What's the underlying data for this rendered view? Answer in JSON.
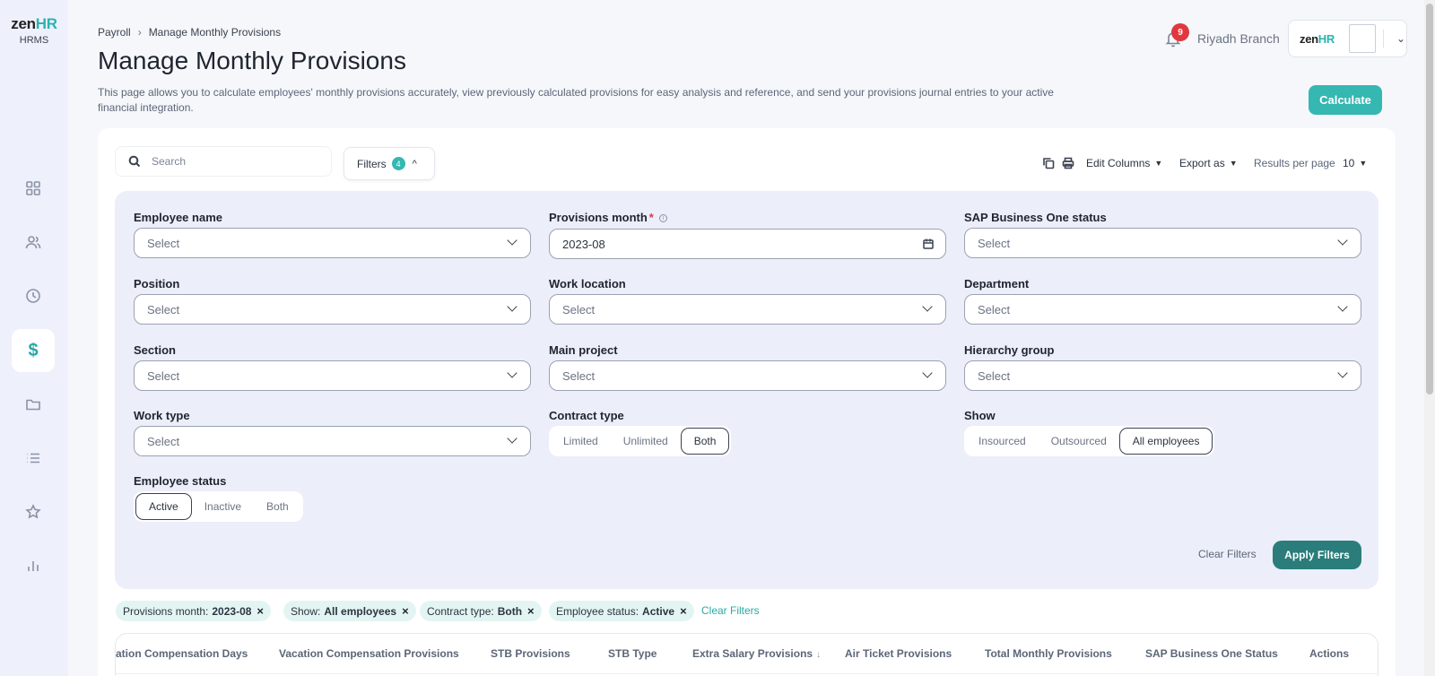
{
  "app": {
    "logo_main": "zen",
    "logo_accent": "HR",
    "logo_sub": "HRMS"
  },
  "sidebar": {
    "items": [
      {
        "name": "dashboard",
        "icon": "grid-icon"
      },
      {
        "name": "employees",
        "icon": "people-icon"
      },
      {
        "name": "time",
        "icon": "clock-icon"
      },
      {
        "name": "payroll",
        "icon": "dollar-icon",
        "active": true,
        "glyph": "$"
      },
      {
        "name": "documents",
        "icon": "folder-icon"
      },
      {
        "name": "lists",
        "icon": "list-icon"
      },
      {
        "name": "performance",
        "icon": "star-icon"
      },
      {
        "name": "reports",
        "icon": "bar-chart-icon"
      }
    ]
  },
  "header": {
    "breadcrumb": [
      "Payroll",
      "Manage Monthly Provisions"
    ],
    "title": "Manage Monthly Provisions",
    "description": "This page allows you to calculate employees' monthly provisions accurately, view previously calculated provisions for easy analysis and reference, and send your provisions journal entries to your active financial integration.",
    "notifications_count": "9",
    "branch": "Riyadh Branch",
    "company_logo": "zenHR",
    "calculate_label": "Calculate"
  },
  "toolbar": {
    "search_placeholder": "Search",
    "filters_label": "Filters",
    "filters_count": "4",
    "edit_columns": "Edit Columns",
    "export_as": "Export as",
    "results_per_page_label": "Results per page",
    "results_per_page_value": "10"
  },
  "filters": {
    "employee_name": {
      "label": "Employee name",
      "value": "Select"
    },
    "provisions_month": {
      "label": "Provisions month",
      "required": "*",
      "value": "2023-08"
    },
    "sap_status": {
      "label": "SAP Business One status",
      "value": "Select"
    },
    "position": {
      "label": "Position",
      "value": "Select"
    },
    "work_location": {
      "label": "Work location",
      "value": "Select"
    },
    "department": {
      "label": "Department",
      "value": "Select"
    },
    "section": {
      "label": "Section",
      "value": "Select"
    },
    "main_project": {
      "label": "Main project",
      "value": "Select"
    },
    "hierarchy_group": {
      "label": "Hierarchy group",
      "value": "Select"
    },
    "work_type": {
      "label": "Work type",
      "value": "Select"
    },
    "contract_type": {
      "label": "Contract type",
      "options": [
        "Limited",
        "Unlimited",
        "Both"
      ],
      "selected": "Both"
    },
    "show": {
      "label": "Show",
      "options": [
        "Insourced",
        "Outsourced",
        "All employees"
      ],
      "selected": "All employees"
    },
    "employee_status": {
      "label": "Employee status",
      "options": [
        "Active",
        "Inactive",
        "Both"
      ],
      "selected": "Active"
    },
    "clear_label": "Clear Filters",
    "apply_label": "Apply Filters"
  },
  "chips": [
    {
      "key": "Provisions month:",
      "value": "2023-08"
    },
    {
      "key": "Show:",
      "value": "All employees"
    },
    {
      "key": "Contract type:",
      "value": "Both"
    },
    {
      "key": "Employee status:",
      "value": "Active"
    }
  ],
  "chips_clear": "Clear Filters",
  "table": {
    "columns": [
      "ation Compensation Days",
      "Vacation Compensation Provisions",
      "STB Provisions",
      "STB Type",
      "Extra Salary Provisions",
      "Air Ticket Provisions",
      "Total Monthly Provisions",
      "SAP Business One Status",
      "Actions"
    ],
    "sort_indicator": "↓"
  },
  "colors": {
    "accent": "#35b7b2",
    "apply": "#2a7d7b",
    "badge": "#e0383e",
    "panel": "#eceefa"
  }
}
